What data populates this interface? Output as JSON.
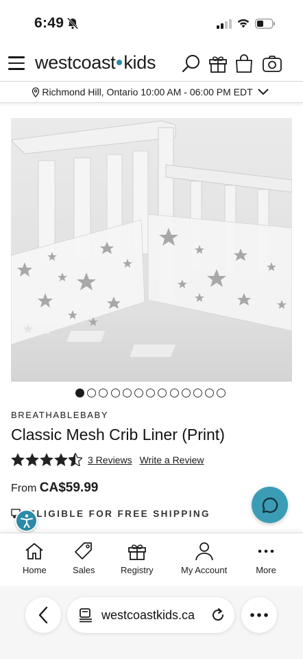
{
  "status": {
    "time": "6:49"
  },
  "header": {
    "logo_left": "westcoast",
    "logo_right": "kids"
  },
  "location": {
    "text": "Richmond Hill, Ontario 10:00 AM - 06:00 PM EDT"
  },
  "carousel": {
    "total": 13,
    "active": 0
  },
  "product": {
    "brand": "BREATHABLEBABY",
    "title": "Classic Mesh Crib Liner (Print)",
    "rating": 4.5,
    "reviews_label": "3 Reviews",
    "write_review": "Write a Review",
    "price_prefix": "From",
    "price": "CA$59.99",
    "shipping": "ELIGIBLE FOR FREE SHIPPING"
  },
  "bottom_nav": [
    {
      "label": "Home",
      "icon": "home-icon"
    },
    {
      "label": "Sales",
      "icon": "tag-icon"
    },
    {
      "label": "Registry",
      "icon": "gift-icon"
    },
    {
      "label": "My Account",
      "icon": "user-icon"
    },
    {
      "label": "More",
      "icon": "more-dots-icon"
    }
  ],
  "browser": {
    "url": "westcoastkids.ca"
  },
  "colors": {
    "accent": "#3a9db5",
    "logo_dot": "#2a8aa5",
    "text": "#1a1a1a"
  }
}
